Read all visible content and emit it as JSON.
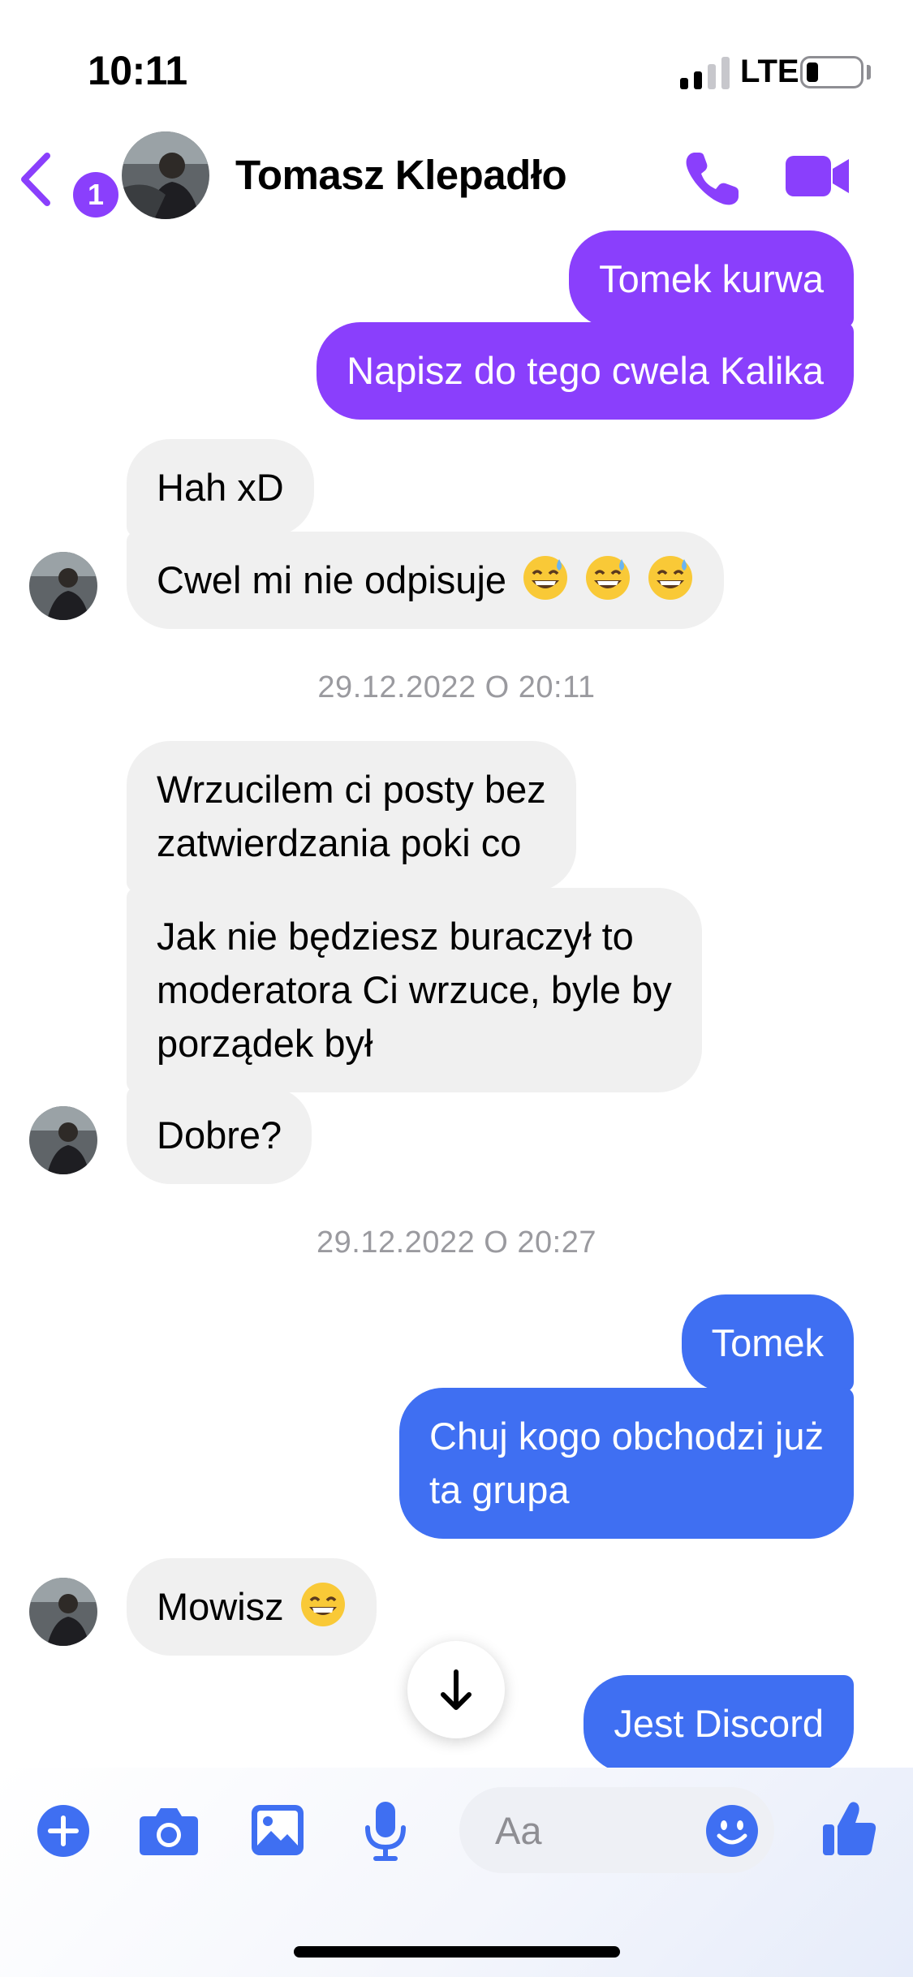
{
  "status_bar": {
    "time": "10:11",
    "network": "LTE"
  },
  "header": {
    "back_badge_count": "1",
    "contact_name": "Tomasz Klepadło",
    "icons": {
      "back": "chevron-left-icon",
      "call": "phone-icon",
      "video": "video-camera-icon"
    }
  },
  "colors": {
    "accent": "#8a3ffc",
    "sent_purple": "#8a3ffc",
    "sent_blue": "#3f6ff2",
    "received": "#f0f0f0"
  },
  "messages": [
    {
      "side": "out",
      "text": "Tomek kurwa"
    },
    {
      "side": "out",
      "text": "Napisz do tego cwela Kalika"
    },
    {
      "side": "in",
      "text": "Hah xD"
    },
    {
      "side": "in",
      "text": "Cwel mi nie odpisuje"
    },
    {
      "side": "in",
      "text": "Wrzucilem ci posty bez",
      "text2": "zatwierdzania poki co"
    },
    {
      "side": "in",
      "text": "Jak nie będziesz buraczył to",
      "text2": "moderatora Ci wrzuce, byle by",
      "text3": "porządek był"
    },
    {
      "side": "in",
      "text": "Dobre?"
    },
    {
      "side": "out",
      "text": "Tomek"
    },
    {
      "side": "out",
      "text": "Chuj kogo obchodzi już",
      "text2": "ta grupa"
    },
    {
      "side": "in",
      "text": "Mowisz"
    },
    {
      "side": "out",
      "text": "Jest Discord"
    }
  ],
  "timestamps": [
    "29.12.2022 O 20:11",
    "29.12.2022 O 20:27"
  ],
  "composer": {
    "placeholder": "Aa",
    "icons": [
      "plus-icon",
      "camera-icon",
      "image-icon",
      "microphone-icon",
      "emoji-icon",
      "thumbs-up-icon"
    ]
  }
}
